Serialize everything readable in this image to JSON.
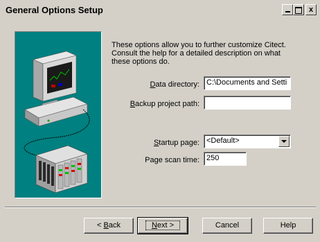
{
  "window": {
    "title": "General Options Setup",
    "minimize_glyph": "",
    "maximize_glyph": "",
    "close_glyph": "x"
  },
  "description": "These options allow you to further customize Citect. Consult the help for a detailed description on what these options do.",
  "fields": {
    "data_directory": {
      "label_pre": "",
      "label_ul": "D",
      "label_post": "ata directory:",
      "value": "C:\\Documents and Setti"
    },
    "backup_path": {
      "label_pre": "",
      "label_ul": "B",
      "label_post": "ackup project path:",
      "value": ""
    },
    "startup_page": {
      "label_pre": "",
      "label_ul": "S",
      "label_post": "tartup page:",
      "value": "<Default>"
    },
    "page_scan_time": {
      "label_pre": "Page scan time:",
      "label_ul": "",
      "label_post": "",
      "value": "250"
    }
  },
  "buttons": {
    "back": {
      "pre": "< ",
      "ul": "B",
      "post": "ack"
    },
    "next": {
      "pre": "",
      "ul": "N",
      "post": "ext >"
    },
    "cancel": {
      "pre": "Cancel",
      "ul": "",
      "post": ""
    },
    "help": {
      "pre": "Help",
      "ul": "",
      "post": ""
    }
  },
  "illustration": {
    "background": "#008080",
    "icons": [
      "computer-icon",
      "plc-rack-icon"
    ]
  }
}
